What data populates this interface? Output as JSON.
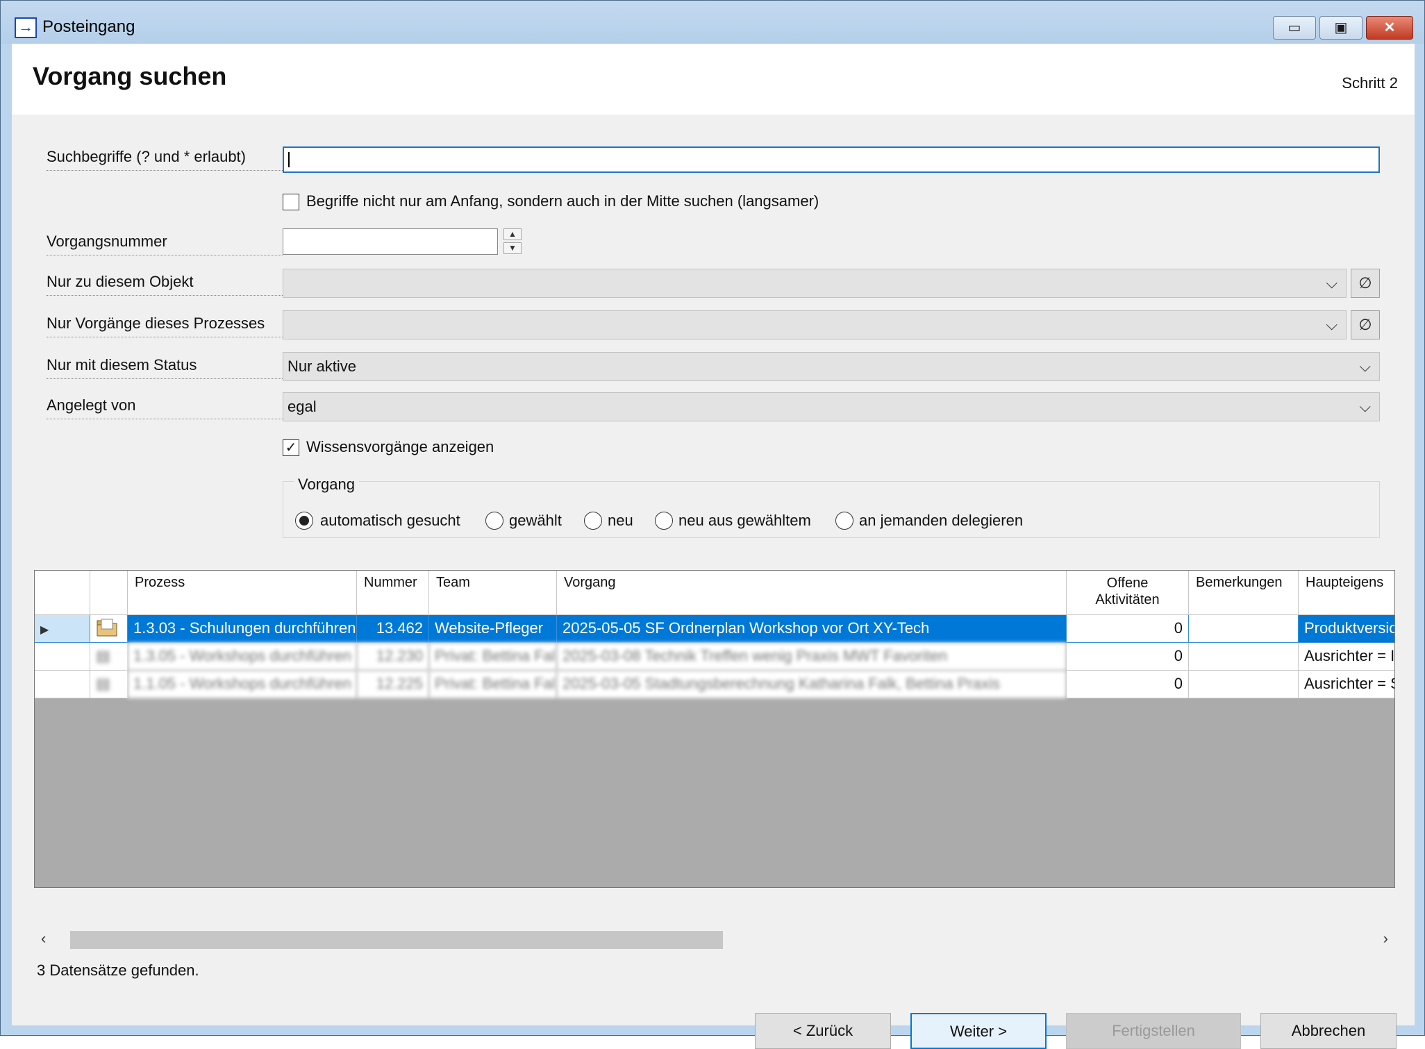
{
  "window": {
    "title": "Posteingang",
    "icon": "arrow-right-icon",
    "min_label": "▭",
    "max_label": "▣",
    "close_label": "✕"
  },
  "header": {
    "title": "Vorgang suchen",
    "step": "Schritt 2"
  },
  "form": {
    "search_label": "Suchbegriffe (? und * erlaubt)",
    "search_value": "",
    "middle_search_label": "Begriffe nicht nur am Anfang, sondern auch in der Mitte suchen (langsamer)",
    "middle_search_checked": false,
    "number_label": "Vorgangsnummer",
    "number_value": "",
    "object_label": "Nur zu diesem Objekt",
    "object_value": "",
    "process_label": "Nur Vorgänge dieses Prozesses",
    "process_value": "",
    "status_label": "Nur mit diesem Status",
    "status_value": "Nur aktive",
    "created_label": "Angelegt von",
    "created_value": "egal",
    "knowledge_label": "Wissensvorgänge anzeigen",
    "knowledge_checked": true,
    "clear_symbol": "∅"
  },
  "vorgang_group": {
    "title": "Vorgang",
    "options": [
      {
        "label": "automatisch gesucht",
        "selected": true
      },
      {
        "label": "gewählt",
        "selected": false
      },
      {
        "label": "neu",
        "selected": false
      },
      {
        "label": "neu aus gewähltem",
        "selected": false
      },
      {
        "label": "an jemanden delegieren",
        "selected": false
      }
    ]
  },
  "grid": {
    "columns": [
      "",
      "",
      "Prozess",
      "Nummer",
      "Team",
      "Vorgang",
      "Offene Aktivitäten",
      "Bemerkungen",
      "Haupteigens"
    ],
    "rows": [
      {
        "prozess": "1.3.03 - Schulungen durchführen",
        "nummer": "13.462",
        "team": "Website-Pfleger",
        "vorgang": "2025-05-05 SF Ordnerplan Workshop vor Ort XY-Tech",
        "offene": "0",
        "bemerkungen": "",
        "haupt": "Produktversio",
        "selected": true
      },
      {
        "prozess": "1.3.05 - Workshops durchführen",
        "nummer": "12.230",
        "team": "Privat: Bettina Falk",
        "vorgang": "2025-03-08 Technik Treffen wenig Praxis MWT Favoriten",
        "offene": "0",
        "bemerkungen": "",
        "haupt": "Ausrichter = I",
        "selected": false
      },
      {
        "prozess": "1.1.05 - Workshops durchführen",
        "nummer": "12.225",
        "team": "Privat: Bettina Falk",
        "vorgang": "2025-03-05 Stadtungsberechnung Katharina Falk, Bettina Praxis",
        "offene": "0",
        "bemerkungen": "",
        "haupt": "Ausrichter = S",
        "selected": false
      }
    ]
  },
  "status_text": "3 Datensätze gefunden.",
  "buttons": {
    "back": "< Zurück",
    "next": "Weiter >",
    "finish": "Fertigstellen",
    "cancel": "Abbrechen"
  }
}
